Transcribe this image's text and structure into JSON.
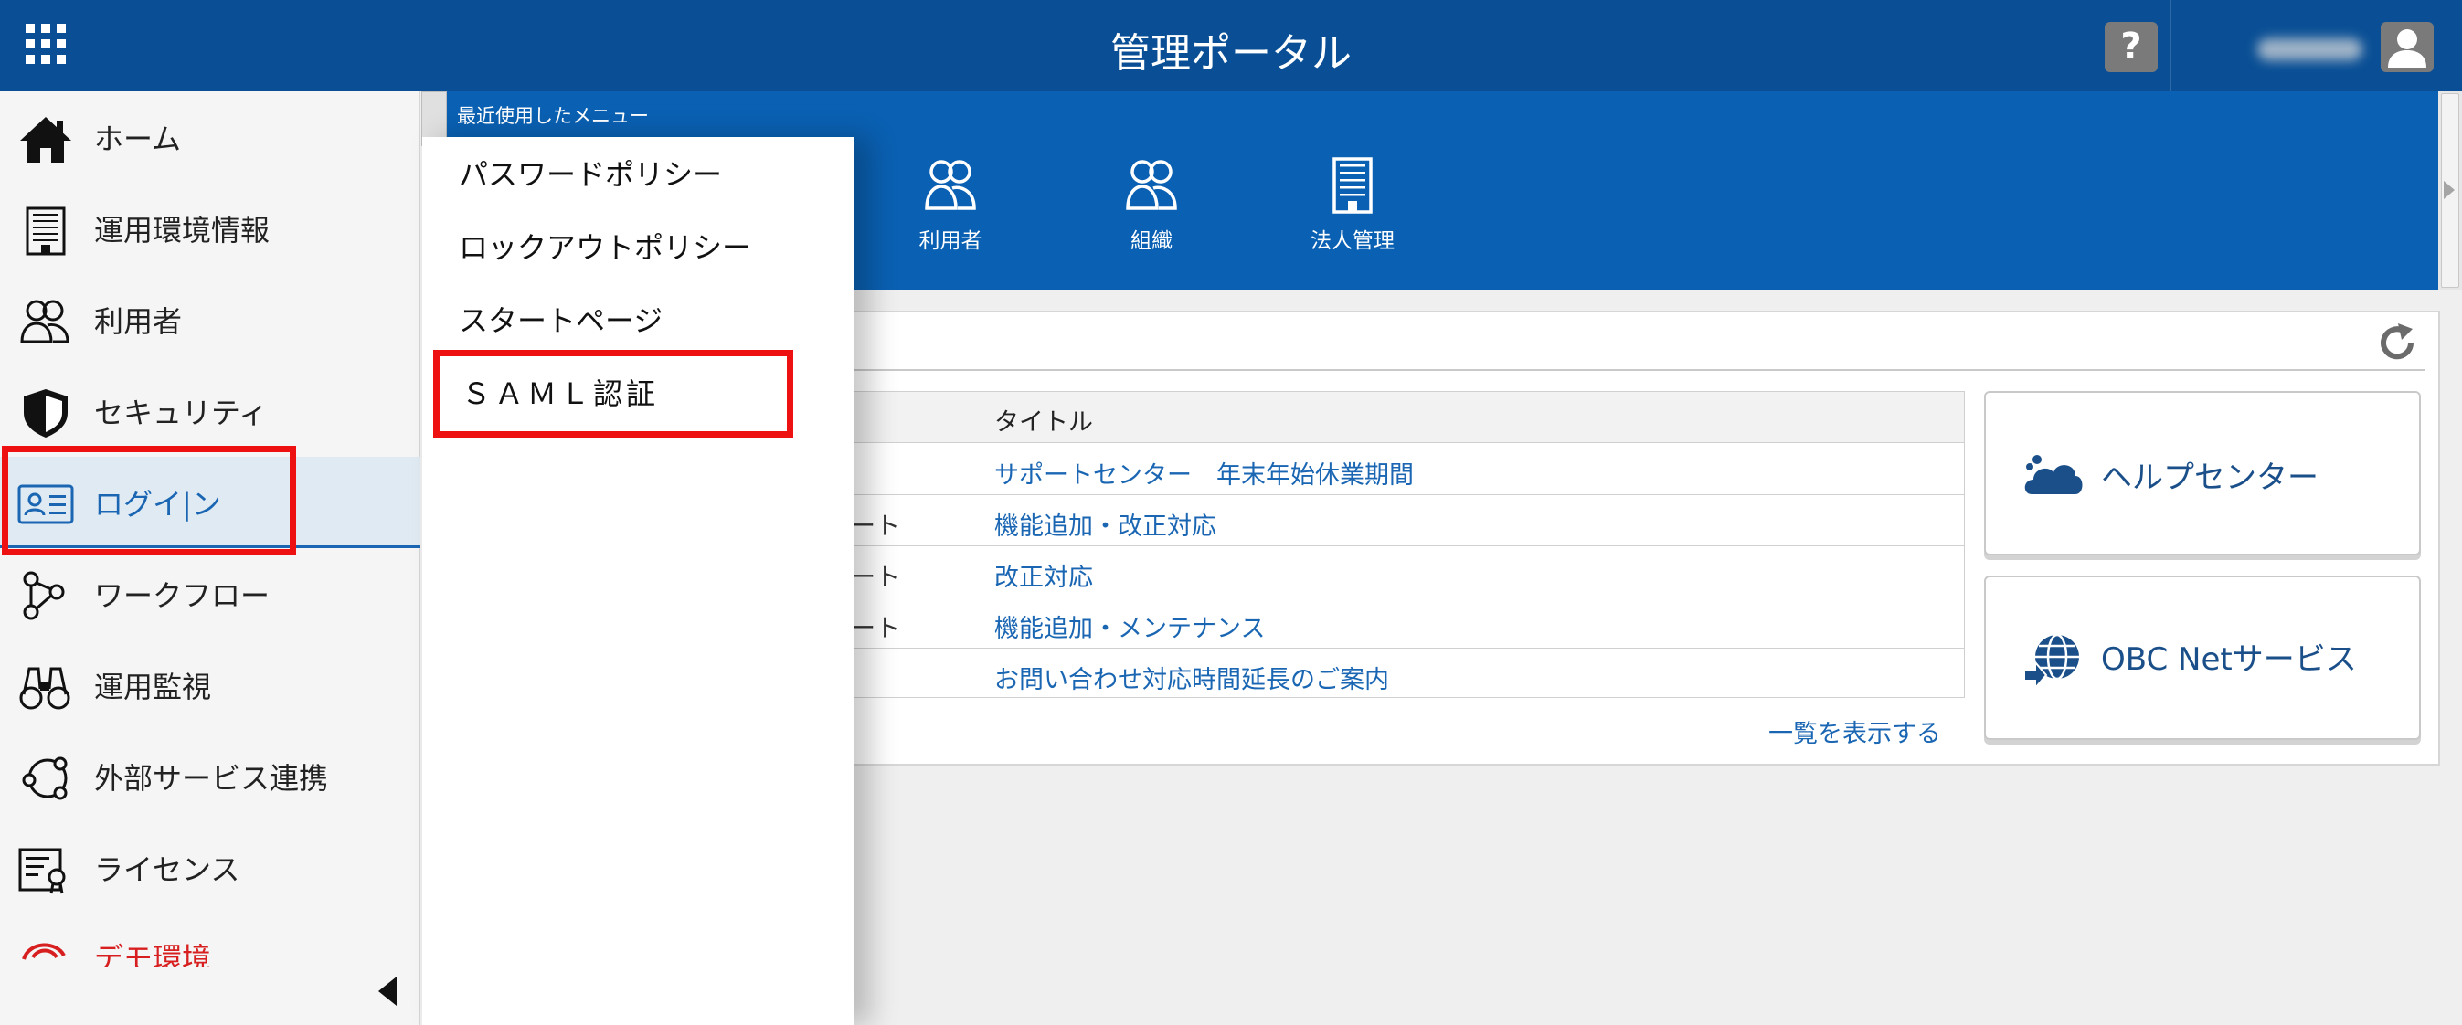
{
  "header": {
    "title": "管理ポータル",
    "help_label": "?"
  },
  "sidebar": {
    "items": [
      {
        "label": "ホーム",
        "icon": "home-icon"
      },
      {
        "label": "運用環境情報",
        "icon": "building-icon"
      },
      {
        "label": "利用者",
        "icon": "users-icon"
      },
      {
        "label": "セキュリティ",
        "icon": "shield-icon"
      },
      {
        "label": "ログイ|ン",
        "icon": "id-card-icon",
        "active": true
      },
      {
        "label": "ワークフロー",
        "icon": "workflow-icon"
      },
      {
        "label": "運用監視",
        "icon": "binoculars-icon"
      },
      {
        "label": "外部サービス連携",
        "icon": "integration-icon"
      },
      {
        "label": "ライセンス",
        "icon": "license-icon"
      },
      {
        "label": "デモ環境",
        "icon": "demo-icon"
      }
    ]
  },
  "recent_menu": {
    "label": "最近使用したメニュー",
    "items": [
      {
        "label": "利用者",
        "icon": "users-icon"
      },
      {
        "label": "組織",
        "icon": "organization-icon"
      },
      {
        "label": "法人管理",
        "icon": "building-icon"
      }
    ]
  },
  "dropdown": {
    "items": [
      "パスワードポリシー",
      "ロックアウトポリシー",
      "スタートページ",
      "ＳＡＭＬ認証"
    ]
  },
  "news": {
    "column_title": "タイトル",
    "rows": [
      {
        "category": "",
        "title": "サポートセンター　年末年始休業期間"
      },
      {
        "category": "ート",
        "title": "機能追加・改正対応"
      },
      {
        "category": "ート",
        "title": "改正対応"
      },
      {
        "category": "ート",
        "title": "機能追加・メンテナンス"
      },
      {
        "category": "",
        "title": "お問い合わせ対応時間延長のご案内"
      }
    ],
    "show_all": "一覧を表示する"
  },
  "cards": {
    "help_center": "ヘルプセンター",
    "obc_net": "OBC Netサービス"
  },
  "colors": {
    "header": "#0a4f95",
    "recent_bar": "#0a60b2",
    "link": "#1a66b3",
    "highlight": "#ee1111",
    "demo": "#d71f1f"
  }
}
